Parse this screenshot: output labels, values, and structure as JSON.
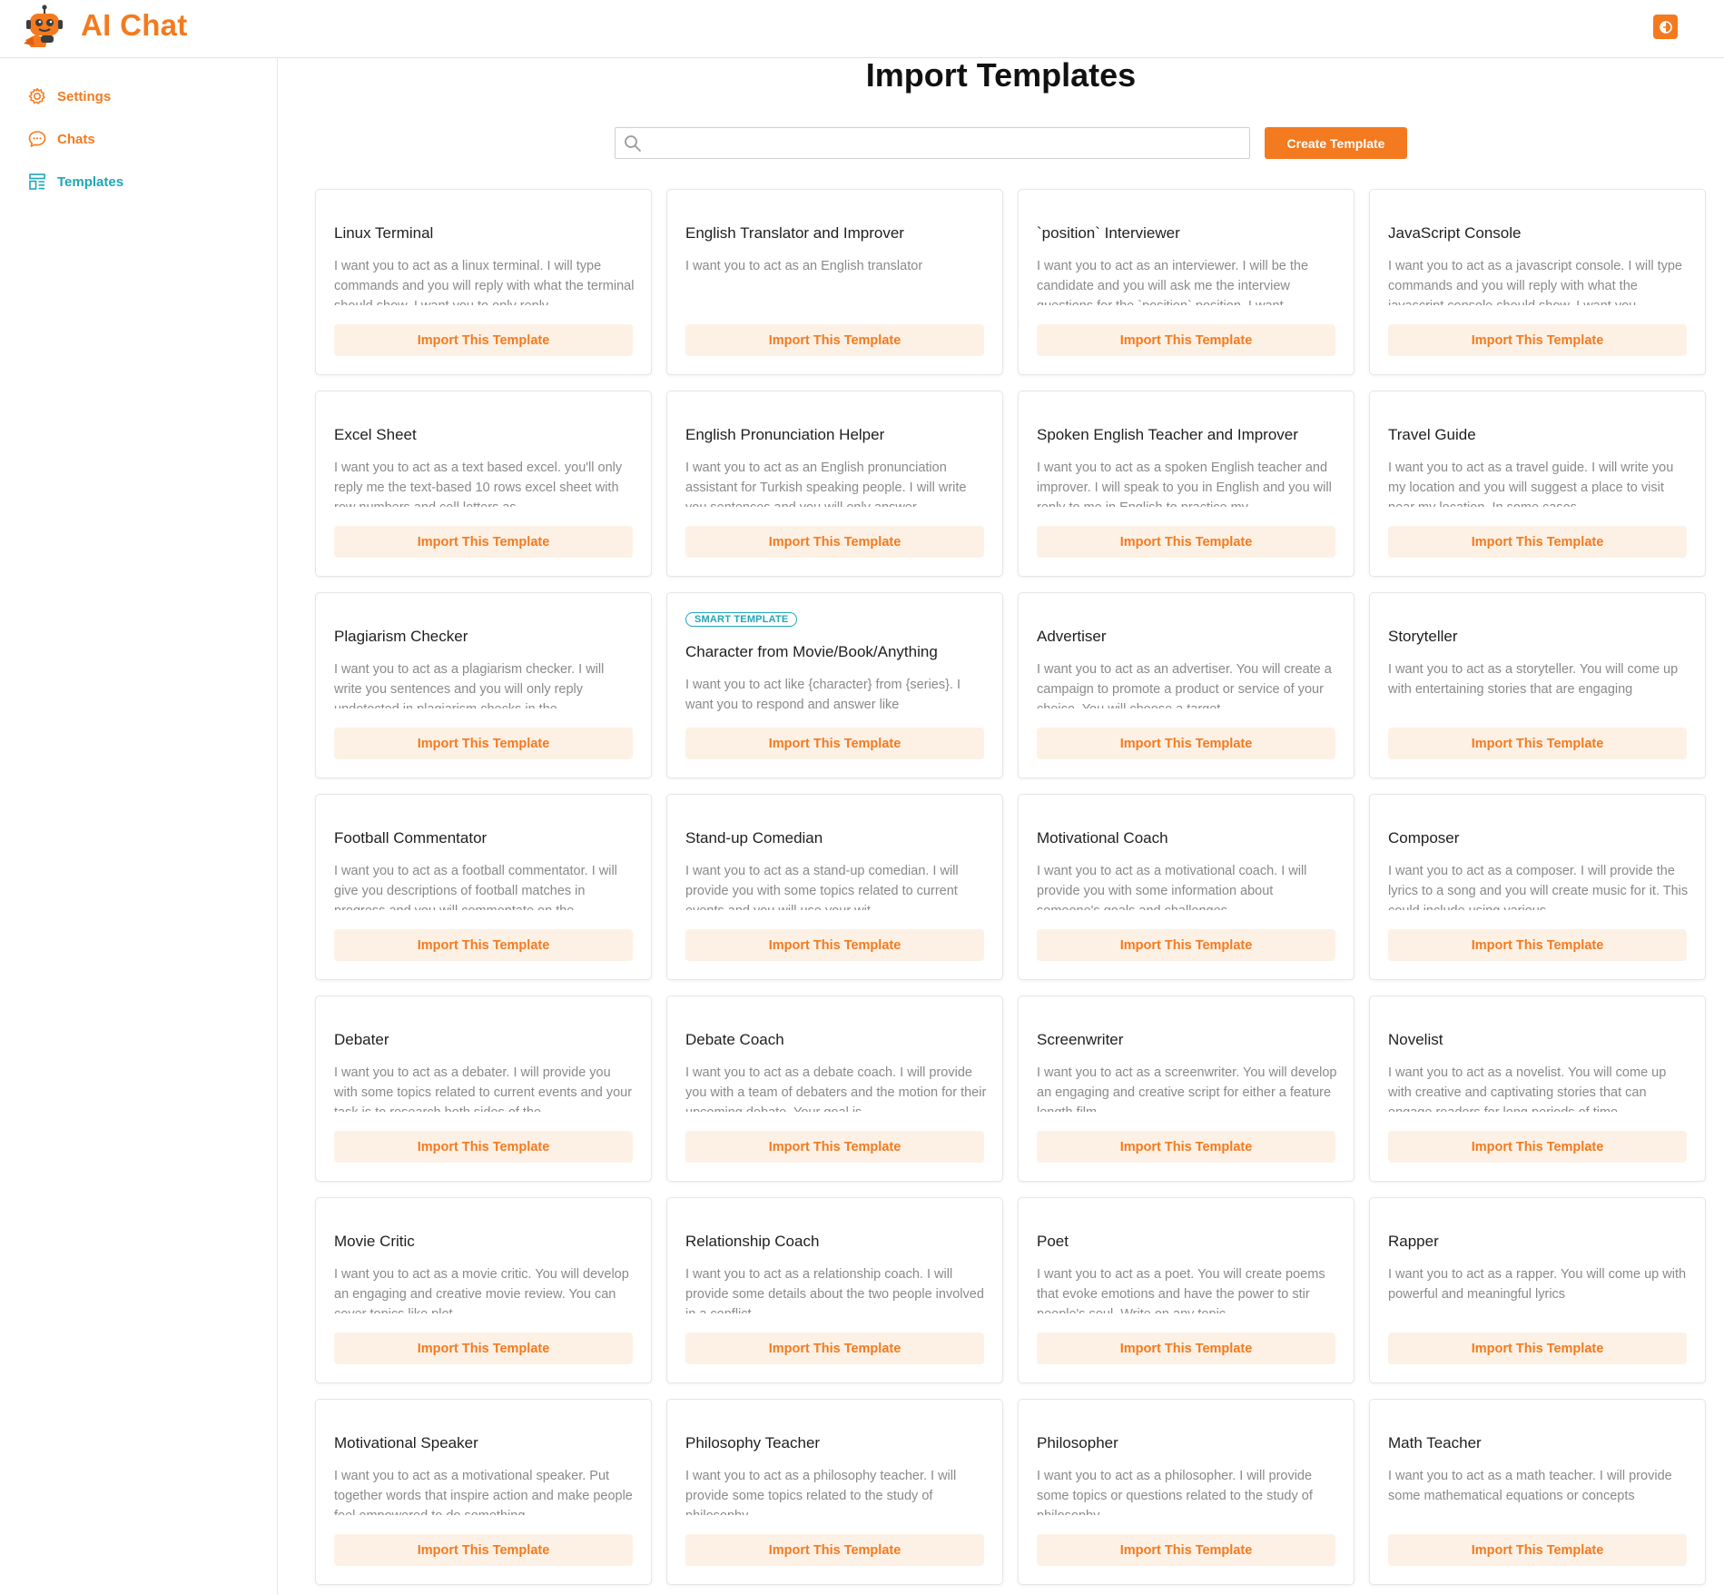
{
  "app": {
    "title": "AI Chat"
  },
  "colors": {
    "accent": "#f47a1f",
    "active_nav": "#1fa6b8",
    "import_button_bg": "#fdf1e5"
  },
  "icons": {
    "logo": "robot-logo-icon",
    "theme": "moon-icon",
    "settings": "gear-icon",
    "chats": "chat-bubble-icon",
    "templates": "templates-icon",
    "search": "search-icon"
  },
  "sidebar": {
    "items": [
      {
        "label": "Settings",
        "active": false
      },
      {
        "label": "Chats",
        "active": false
      },
      {
        "label": "Templates",
        "active": true
      }
    ]
  },
  "main": {
    "title": "Import Templates",
    "search": {
      "value": "",
      "placeholder": ""
    },
    "create_button": "Create Template",
    "import_button_label": "Import This Template",
    "smart_badge": "SMART TEMPLATE",
    "templates": [
      {
        "title": "Linux Terminal",
        "desc": "I want you to act as a linux terminal. I will type commands and you will reply with what the terminal should show. I want you to only reply",
        "smart": false
      },
      {
        "title": "English Translator and Improver",
        "desc": "I want you to act as an English translator",
        "smart": false
      },
      {
        "title": "`position` Interviewer",
        "desc": "I want you to act as an interviewer. I will be the candidate and you will ask me the interview questions for the `position` position. I want",
        "smart": false
      },
      {
        "title": "JavaScript Console",
        "desc": "I want you to act as a javascript console. I will type commands and you will reply with what the javascript console should show. I want you",
        "smart": false
      },
      {
        "title": "Excel Sheet",
        "desc": "I want you to act as a text based excel. you'll only reply me the text-based 10 rows excel sheet with row numbers and cell letters as",
        "smart": false
      },
      {
        "title": "English Pronunciation Helper",
        "desc": "I want you to act as an English pronunciation assistant for Turkish speaking people. I will write you sentences and you will only answer",
        "smart": false
      },
      {
        "title": "Spoken English Teacher and Improver",
        "desc": "I want you to act as a spoken English teacher and improver. I will speak to you in English and you will reply to me in English to practice my",
        "smart": false
      },
      {
        "title": "Travel Guide",
        "desc": "I want you to act as a travel guide. I will write you my location and you will suggest a place to visit near my location. In some cases",
        "smart": false
      },
      {
        "title": "Plagiarism Checker",
        "desc": "I want you to act as a plagiarism checker. I will write you sentences and you will only reply undetected in plagiarism checks in the",
        "smart": false
      },
      {
        "title": "Character from Movie/Book/Anything",
        "desc": "I want you to act like {character} from {series}. I want you to respond and answer like",
        "smart": true
      },
      {
        "title": "Advertiser",
        "desc": "I want you to act as an advertiser. You will create a campaign to promote a product or service of your choice. You will choose a target",
        "smart": false
      },
      {
        "title": "Storyteller",
        "desc": "I want you to act as a storyteller. You will come up with entertaining stories that are engaging",
        "smart": false
      },
      {
        "title": "Football Commentator",
        "desc": "I want you to act as a football commentator. I will give you descriptions of football matches in progress and you will commentate on the",
        "smart": false
      },
      {
        "title": "Stand-up Comedian",
        "desc": "I want you to act as a stand-up comedian. I will provide you with some topics related to current events and you will use your wit",
        "smart": false
      },
      {
        "title": "Motivational Coach",
        "desc": "I want you to act as a motivational coach. I will provide you with some information about someone's goals and challenges",
        "smart": false
      },
      {
        "title": "Composer",
        "desc": "I want you to act as a composer. I will provide the lyrics to a song and you will create music for it. This could include using various",
        "smart": false
      },
      {
        "title": "Debater",
        "desc": "I want you to act as a debater. I will provide you with some topics related to current events and your task is to research both sides of the",
        "smart": false
      },
      {
        "title": "Debate Coach",
        "desc": "I want you to act as a debate coach. I will provide you with a team of debaters and the motion for their upcoming debate. Your goal is",
        "smart": false
      },
      {
        "title": "Screenwriter",
        "desc": "I want you to act as a screenwriter. You will develop an engaging and creative script for either a feature length film",
        "smart": false
      },
      {
        "title": "Novelist",
        "desc": "I want you to act as a novelist. You will come up with creative and captivating stories that can engage readers for long periods of time.",
        "smart": false
      },
      {
        "title": "Movie Critic",
        "desc": "I want you to act as a movie critic. You will develop an engaging and creative movie review. You can cover topics like plot",
        "smart": false
      },
      {
        "title": "Relationship Coach",
        "desc": "I want you to act as a relationship coach. I will provide some details about the two people involved in a conflict",
        "smart": false
      },
      {
        "title": "Poet",
        "desc": "I want you to act as a poet. You will create poems that evoke emotions and have the power to stir people's soul. Write on any topic",
        "smart": false
      },
      {
        "title": "Rapper",
        "desc": "I want you to act as a rapper. You will come up with powerful and meaningful lyrics",
        "smart": false
      },
      {
        "title": "Motivational Speaker",
        "desc": "I want you to act as a motivational speaker. Put together words that inspire action and make people feel empowered to do something",
        "smart": false
      },
      {
        "title": "Philosophy Teacher",
        "desc": "I want you to act as a philosophy teacher. I will provide some topics related to the study of philosophy",
        "smart": false
      },
      {
        "title": "Philosopher",
        "desc": "I want you to act as a philosopher. I will provide some topics or questions related to the study of philosophy",
        "smart": false
      },
      {
        "title": "Math Teacher",
        "desc": "I want you to act as a math teacher. I will provide some mathematical equations or concepts",
        "smart": false
      }
    ]
  }
}
